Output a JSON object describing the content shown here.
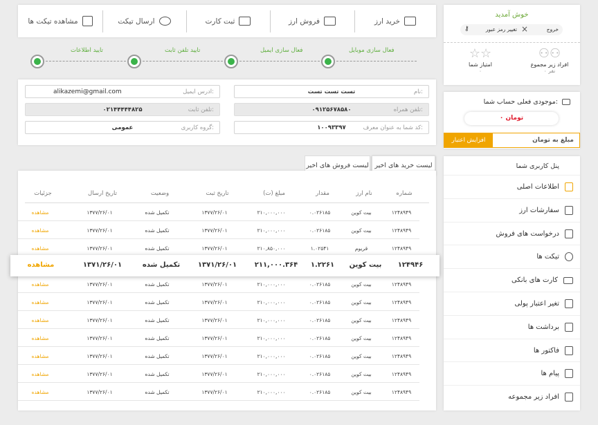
{
  "toolbar": {
    "buy": "خرید ارز",
    "sell": "فروش ارز",
    "card": "ثبت کارت",
    "send_ticket": "ارسال تیکت",
    "view_tickets": "مشاهده تیکت ها"
  },
  "steps": [
    "فعال سازی موبایل",
    "فعال سازی ایمیل",
    "تایید تلفن ثابت",
    "تایید اطلاعات"
  ],
  "form": {
    "name_label": "نام:",
    "name_value": "تست تست تست",
    "email_label": "ادرس ایمیل:",
    "email_value": "alikazemi@gmail.com",
    "mobile_label": "تلفن همراه:",
    "mobile_value": "۰۹۱۲۵۶۷۸۵۸۰",
    "phone_label": "تلفن ثابت:",
    "phone_value": "۰۲۱۴۴۴۴۴۸۲۵",
    "ref_label": "کد شما به عنوان معرف:",
    "ref_value": "۱۰۰۹۳۳۹۷",
    "group_label": "گروه کاربری:",
    "group_value": "عمومی"
  },
  "tabs": {
    "recent_buys": "لیست خرید های اخیر",
    "recent_sells": "لیست فروش های اخیر"
  },
  "table": {
    "headers": [
      "شماره",
      "نام ارز",
      "مقدار",
      "مبلغ (ت)",
      "تاریخ ثبت",
      "وضعیت",
      "تاریخ ارسال",
      "جزئیات"
    ],
    "rows": [
      [
        "۱۲۴۸۹۴۹",
        "بیت کوین",
        "۰.۰۲۶۱۸۵",
        "۲۱۰,۰۰۰,۰۰۰",
        "۱۳۷۷/۲۶/۰۱",
        "تکمیل شده",
        "۱۳۷۷/۲۶/۰۱",
        "مشاهده"
      ],
      [
        "۱۲۴۸۹۴۹",
        "بیت کوین",
        "۰.۰۲۶۱۸۵",
        "۲۱۰,۰۰۰,۰۰۰",
        "۱۳۷۷/۲۶/۰۱",
        "تکمیل شده",
        "۱۳۷۷/۲۶/۰۱",
        "مشاهده"
      ],
      [
        "۱۲۴۸۹۴۹",
        "قریوم",
        "۱.۰۲۵۴۱",
        "۲۱۰,۸۵۰,۰۰۰",
        "۱۳۷۷/۲۶/۰۱",
        "تکمیل شده",
        "۱۳۷۷/۲۶/۰۱",
        "مشاهده"
      ],
      [
        "۱۲۴۸۹۴۹",
        "بیت کوین",
        "۰.۰۲۶۱۸۵",
        "۲۱۰,۰۰۰,۰۰۰",
        "۱۳۷۷/۲۶/۰۱",
        "تکمیل شده",
        "۱۳۷۷/۲۶/۰۱",
        "مشاهده"
      ],
      [
        "۱۲۴۸۹۴۹",
        "بیت کوین",
        "۰.۰۲۶۱۸۵",
        "۲۱۰,۰۰۰,۰۰۰",
        "۱۳۷۷/۲۶/۰۱",
        "تکمیل شده",
        "۱۳۷۷/۲۶/۰۱",
        "مشاهده"
      ],
      [
        "۱۲۴۸۹۴۹",
        "بیت کوین",
        "۰.۰۲۶۱۸۵",
        "۲۱۰,۰۰۰,۰۰۰",
        "۱۳۷۷/۲۶/۰۱",
        "تکمیل شده",
        "۱۳۷۷/۲۶/۰۱",
        "مشاهده"
      ],
      [
        "۱۲۴۸۹۴۹",
        "بیت کوین",
        "۰.۰۲۶۱۸۵",
        "۲۱۰,۰۰۰,۰۰۰",
        "۱۳۷۷/۲۶/۰۱",
        "تکمیل شده",
        "۱۳۷۷/۲۶/۰۱",
        "مشاهده"
      ],
      [
        "۱۲۴۸۹۴۹",
        "بیت کوین",
        "۰.۰۲۶۱۸۵",
        "۲۱۰,۰۰۰,۰۰۰",
        "۱۳۷۷/۲۶/۰۱",
        "تکمیل شده",
        "۱۳۷۷/۲۶/۰۱",
        "مشاهده"
      ],
      [
        "۱۲۴۸۹۴۹",
        "بیت کوین",
        "۰.۰۲۶۱۸۵",
        "۲۱۰,۰۰۰,۰۰۰",
        "۱۳۷۷/۲۶/۰۱",
        "تکمیل شده",
        "۱۳۷۷/۲۶/۰۱",
        "مشاهده"
      ],
      [
        "۱۲۴۸۹۴۹",
        "بیت کوین",
        "۰.۰۲۶۱۸۵",
        "۲۱۰,۰۰۰,۰۰۰",
        "۱۳۷۷/۲۶/۰۱",
        "تکمیل شده",
        "۱۳۷۷/۲۶/۰۱",
        "مشاهده"
      ],
      [
        "۱۲۴۸۹۴۹",
        "بیت کوین",
        "۰.۰۲۶۱۸۵",
        "۲۱۰,۰۰۰,۰۰۰",
        "۱۳۷۷/۲۶/۰۱",
        "تکمیل شده",
        "۱۳۷۷/۲۶/۰۱",
        "مشاهده"
      ]
    ],
    "highlight": [
      "۱۲۴۹۴۶",
      "بیت کوین",
      "۱.۲۲۶۱",
      "۲۱۱,۰۰۰.۳۶۴",
      "۱۳۷۱/۲۶/۰۱",
      "تکمیل شده",
      "۱۳۷۱/۲۶/۰۱",
      "مشاهده"
    ]
  },
  "welcome": {
    "title": "خوش آمدید",
    "logout": "خروج",
    "change_password": "تغییر رمز عبور",
    "referrals_label": "افراد زیر مجموع",
    "referrals_count": "۰ نفر",
    "points_label": "امتیاز شما",
    "points_value": "۰"
  },
  "balance": {
    "title": "موجودی فعلی حساب شما:",
    "amount": "۰ تومان",
    "input_placeholder": "مبلغ به تومان",
    "button": "افزایش اعتبار"
  },
  "menu": {
    "title": "پنل کاربری شما",
    "items": [
      "اطلاعات اصلی",
      "سفارشات ارز",
      "درخواست های فروش",
      "تیکت ها",
      "کارت های بانکی",
      "تغیر اعتبار پولی",
      "برداشت ها",
      "فاکتور ها",
      "پیام ها",
      "افراد زیر مجموعه"
    ]
  },
  "colors": {
    "accent": "#f0a500",
    "green": "#3bb34a",
    "amount_red": "#e0192b"
  }
}
